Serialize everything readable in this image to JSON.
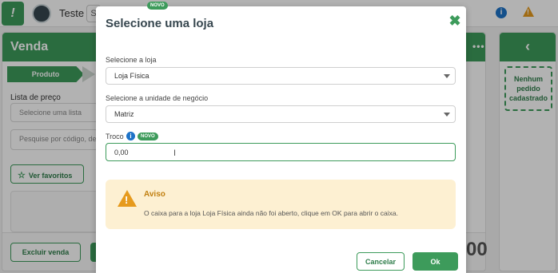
{
  "app": {
    "store_name": "Teste",
    "topbar_chip": "S",
    "info_glyph": "i",
    "warning_glyph": "!",
    "new_badge": "NOVO",
    "logo_glyph": "!"
  },
  "sale_panel": {
    "title": "Venda",
    "menu": "•••",
    "step_product": "Produto",
    "price_list_label": "Lista de preço",
    "price_list_placeholder": "Selecione uma lista",
    "search_placeholder": "Pesquise por código, descrição",
    "favorites_button": "Ver favoritos",
    "exit_button": "Excluir venda",
    "total_partial": "00"
  },
  "orders_panel": {
    "back_glyph": "‹",
    "empty_text": "Nenhum pedido cadastrado"
  },
  "modal": {
    "title": "Selecione uma loja",
    "close_glyph": "✖",
    "store_label": "Selecione a loja",
    "store_value": "Loja Física",
    "unit_label": "Selecione a unidade de negócio",
    "unit_value": "Matriz",
    "change_label": "Troco",
    "change_info": "i",
    "change_badge": "NOVO",
    "change_value": "0,00",
    "alert_title": "Aviso",
    "alert_icon": "!",
    "alert_message": "O caixa para a loja Loja Física ainda não foi aberto, clique em OK para abrir o caixa.",
    "cancel_label": "Cancelar",
    "ok_label": "Ok"
  },
  "colors": {
    "brand_green": "#3d9b5b",
    "alert_bg": "#fdf0d2",
    "alert_title": "#c17f0f",
    "info_blue": "#1e73c8",
    "warning_orange": "#e69a1c"
  },
  "icons": [
    "logo-icon",
    "store-avatar",
    "info-icon",
    "warning-icon",
    "menu-dots-icon",
    "star-icon",
    "back-chevron-icon",
    "close-icon",
    "chevron-down-icon",
    "text-cursor-icon"
  ]
}
